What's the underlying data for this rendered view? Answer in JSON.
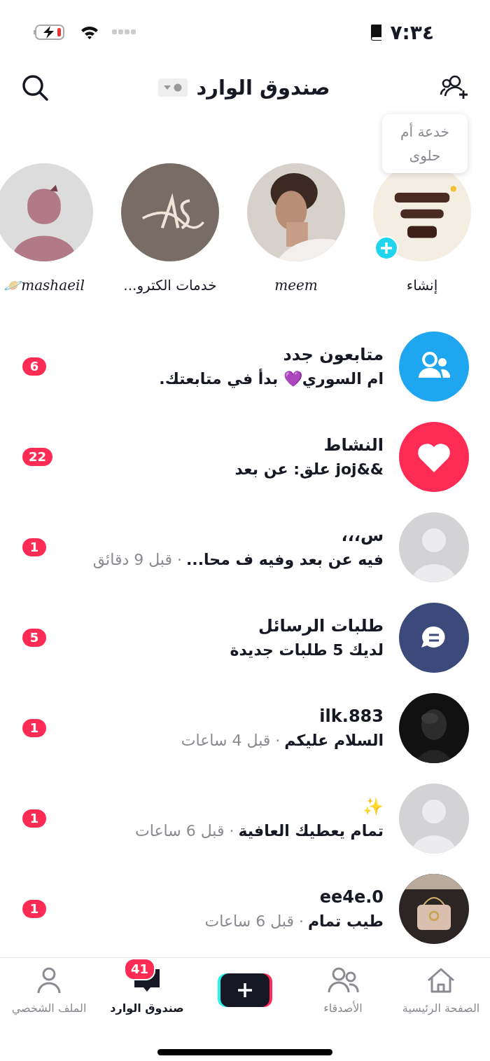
{
  "status_bar": {
    "time": "٧:٣٤"
  },
  "header": {
    "title": "صندوق الوارد"
  },
  "stories": [
    {
      "kind": "create",
      "label": "إنشاء",
      "tooltip": "خدعة أم حلوى"
    },
    {
      "kind": "picture",
      "label": "meem"
    },
    {
      "kind": "picture",
      "label": "خدمات الكترو..."
    },
    {
      "kind": "picture",
      "label": "🪐mashaeil"
    }
  ],
  "rows": [
    {
      "kind": "followers",
      "title": "متابعون جدد",
      "subtitle": "ام السوري💜 بدأ في متابعتك.",
      "badge": "6"
    },
    {
      "kind": "activity",
      "title": "النشاط",
      "subtitle": "&&joj علق: عن بعد",
      "badge": "22"
    },
    {
      "kind": "default",
      "title": "س،،،",
      "subtitle": "فيه عن بعد وفيه ف محا...",
      "time": "· قبل 9 دقائق",
      "badge": "1"
    },
    {
      "kind": "requests",
      "title": "طلبات الرسائل",
      "subtitle": "لديك 5 طلبات جديدة",
      "badge": "5"
    },
    {
      "kind": "picture",
      "title": "ilk.883",
      "subtitle": "السلام عليكم",
      "time": "· قبل 4 ساعات",
      "badge": "1"
    },
    {
      "kind": "default",
      "title": "✨",
      "subtitle": "تمام يعطيك العافية",
      "time": "· قبل 6 ساعات",
      "badge": "1"
    },
    {
      "kind": "picture",
      "title": "ee4e.0",
      "subtitle": "طيب تمام",
      "time": "· قبل 6 ساعات",
      "badge": "1"
    }
  ],
  "nav": [
    {
      "kind": "tab",
      "label": "الصفحة الرئيسية",
      "selected": false
    },
    {
      "kind": "tab",
      "label": "الأصدقاء",
      "selected": false
    },
    {
      "kind": "create"
    },
    {
      "kind": "tab",
      "label": "صندوق الوارد",
      "selected": true,
      "badge": "41"
    },
    {
      "kind": "tab",
      "label": "الملف الشخصي",
      "selected": false
    }
  ]
}
